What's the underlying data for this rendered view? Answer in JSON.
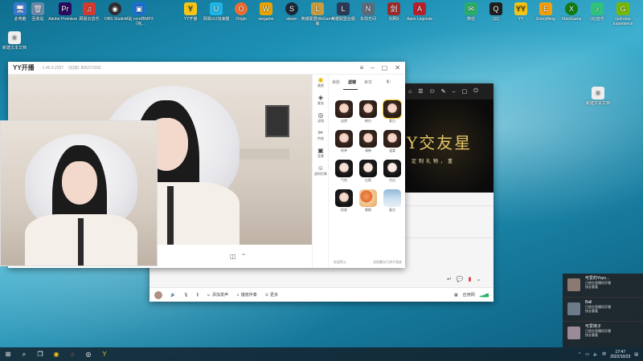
{
  "desktop_icons": [
    {
      "label": "此电脑",
      "icon": "computer-icon",
      "color": "#3a7bd5"
    },
    {
      "label": "回收站",
      "icon": "recycle-bin-icon",
      "color": "#6a8caf"
    },
    {
      "label": "Adobe Premiere ...",
      "icon": "premiere-icon",
      "color": "#2a0a5e"
    },
    {
      "label": "网易云音乐",
      "icon": "netease-music-icon",
      "color": "#d33a31"
    },
    {
      "label": "OBS Studio",
      "icon": "obs-icon",
      "color": "#302e31"
    },
    {
      "label": "M站 ncm转MP3（拖...",
      "icon": "converter-icon",
      "color": "#1c6fd1"
    },
    {
      "label": "YY开播",
      "icon": "yy-icon",
      "color": "#f5c518"
    },
    {
      "label": "网易UU加速器",
      "icon": "uu-icon",
      "color": "#1fb5e8"
    },
    {
      "label": "Origin",
      "icon": "origin-icon",
      "color": "#f56c2d"
    },
    {
      "label": "wegame",
      "icon": "wegame-icon",
      "color": "#e9a400"
    },
    {
      "label": "steam",
      "icon": "steam-icon",
      "color": "#1b2838"
    },
    {
      "label": "英雄联盟WeGame版",
      "icon": "lol-icon",
      "color": "#c89b3c"
    },
    {
      "label": "英雄联盟台服",
      "icon": "lol-tw-icon",
      "color": "#2b3a55"
    },
    {
      "label": "永劫无间",
      "icon": "naraka-icon",
      "color": "#5a6b7c"
    },
    {
      "label": "剑网3",
      "icon": "jx3-icon",
      "color": "#a02a2a"
    },
    {
      "label": "Apex Legends",
      "icon": "apex-icon",
      "color": "#b8202a"
    },
    {
      "label": "微信",
      "icon": "wechat-icon",
      "color": "#2aae67"
    },
    {
      "label": "QQ",
      "icon": "qq-icon",
      "color": "#1e1e1e"
    },
    {
      "label": "YY",
      "icon": "yy-app-icon",
      "color": "#f5c518"
    },
    {
      "label": "Everything",
      "icon": "everything-icon",
      "color": "#f59e0b"
    },
    {
      "label": "XboxGame",
      "icon": "xbox-icon",
      "color": "#107c10"
    },
    {
      "label": "QQ音乐",
      "icon": "qqmusic-icon",
      "color": "#31c27c"
    },
    {
      "label": "GeForce Experience",
      "icon": "geforce-icon",
      "color": "#76b900"
    },
    {
      "label": "新建文本文档",
      "icon": "text-file-icon",
      "color": "#eeeeee"
    },
    {
      "label": "新建文本文档",
      "icon": "text-file-icon",
      "color": "#eeeeee"
    }
  ],
  "yy_window": {
    "logo": "YY开播",
    "version": "1.45.0.2357",
    "account": "QQ如: 805371592",
    "beauty_panel": {
      "side_items": [
        {
          "label": "美颜",
          "icon": "beauty-icon"
        },
        {
          "label": "美妆",
          "icon": "makeup-icon"
        },
        {
          "label": "滤镜",
          "icon": "filter-icon"
        },
        {
          "label": "特效",
          "icon": "effects-icon"
        },
        {
          "label": "背景",
          "icon": "background-icon"
        },
        {
          "label": "虚拟形象",
          "icon": "avatar-icon"
        }
      ],
      "tabs": [
        "美颜",
        "滤镜",
        "美妆"
      ],
      "active_tab": "滤镜",
      "filters": [
        "自然",
        "粉白",
        "夏日",
        "奶茶",
        "清新",
        "温柔",
        "气色",
        "白皙",
        "冷白",
        "奶杏",
        "蜜桃",
        "复古"
      ],
      "footer_left": "恢复默认",
      "footer_right": "滤镜叠加可调节强度"
    }
  },
  "yy2_window": {
    "banner_big": "Y交友星",
    "banner_small": "定制礼物，重",
    "bottom_bar": {
      "items": [
        {
          "label": "",
          "icon": "avatar-icon"
        },
        {
          "label": "",
          "icon": "speaker-icon"
        },
        {
          "label": "",
          "icon": "mic-icon"
        },
        {
          "label": "",
          "icon": "mixer-icon"
        },
        {
          "label": "添加发声",
          "icon": "voice-icon"
        },
        {
          "label": "播放伴奏",
          "icon": "music-icon"
        },
        {
          "label": "更多",
          "icon": "more-icon"
        }
      ],
      "right_label": "应用网"
    }
  },
  "notifications": [
    {
      "name": "可爱的Yoyo...",
      "line1": "已经在直播间开播",
      "line2": "快去看看"
    },
    {
      "name": "Ball",
      "line1": "已经在直播间开播",
      "line2": "快去看看"
    },
    {
      "name": "可爱妹子",
      "line1": "已经在直播间开播",
      "line2": "快去看看"
    }
  ],
  "taskbar": {
    "time": "17:47",
    "date": "2022/10/23",
    "apps": [
      "windows-start-icon",
      "search-icon",
      "task-view-icon",
      "chrome-icon",
      "netease-music-icon",
      "obs-icon",
      "yy-icon"
    ]
  }
}
